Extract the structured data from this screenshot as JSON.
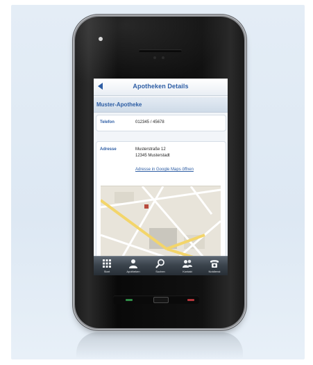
{
  "colors": {
    "accent": "#2d5da4",
    "background": "#e4edf6",
    "phone_body": "#0d0d0d",
    "tabbar": "#3a434c"
  },
  "navbar": {
    "title": "Apotheken Details",
    "back_icon": "chevron-left-icon"
  },
  "pharmacy": {
    "name": "Muster-Apotheke"
  },
  "phone_field": {
    "label": "Telefon",
    "value": "012345 / 45678"
  },
  "address_field": {
    "label": "Adresse",
    "line1": "Musterstraße 12",
    "line2": "12345 Musterstadt",
    "maps_link": "Adresse in Google Maps öffnen"
  },
  "tabbar": {
    "tabs": [
      {
        "label": "Start",
        "icon": "grid-icon"
      },
      {
        "label": "Apotheken",
        "icon": "pharmacist-icon"
      },
      {
        "label": "Suchen",
        "icon": "search-icon"
      },
      {
        "label": "Kontakt",
        "icon": "people-icon"
      },
      {
        "label": "Notdienst",
        "icon": "telephone-icon"
      }
    ]
  }
}
